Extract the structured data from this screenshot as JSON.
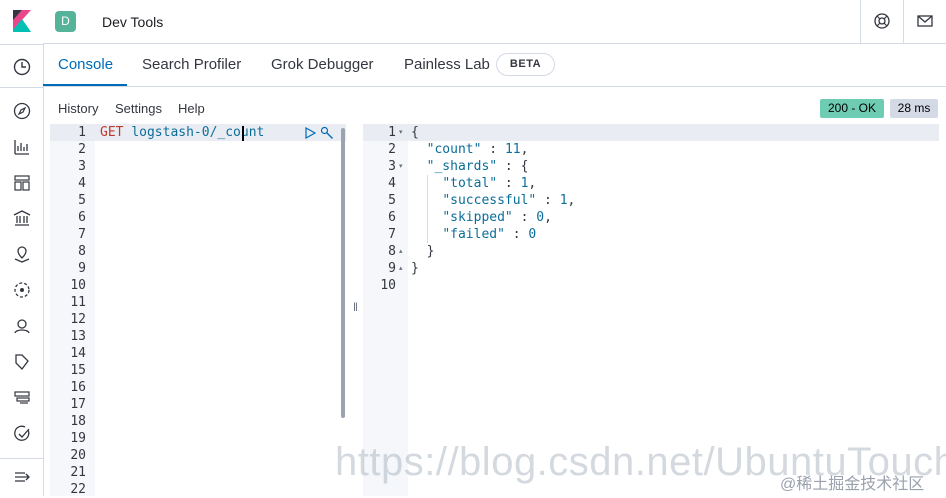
{
  "app": {
    "title": "Dev Tools",
    "space_initial": "D"
  },
  "sidebar": {
    "icons": [
      "clock-icon",
      "compass-icon",
      "chart-icon",
      "dashboard-icon",
      "bank-icon",
      "map-icon",
      "ml-icon",
      "user-icon",
      "apm-icon",
      "stack-icon",
      "uptime-icon",
      "dock-icon"
    ]
  },
  "tabs": [
    {
      "label": "Console",
      "active": true
    },
    {
      "label": "Search Profiler",
      "active": false
    },
    {
      "label": "Grok Debugger",
      "active": false
    },
    {
      "label": "Painless Lab",
      "active": false
    }
  ],
  "beta_label": "BETA",
  "menu": {
    "history": "History",
    "settings": "Settings",
    "help": "Help"
  },
  "status": {
    "code": "200 - OK",
    "time": "28 ms"
  },
  "request": {
    "method": "GET",
    "path": "logstash-0/_count",
    "line_numbers": [
      "1",
      "2",
      "3",
      "4",
      "5",
      "6",
      "7",
      "8",
      "9",
      "10",
      "11",
      "12",
      "13",
      "14",
      "15",
      "16",
      "17",
      "18",
      "19",
      "20",
      "21",
      "22"
    ]
  },
  "response": {
    "line_numbers": [
      "1",
      "2",
      "3",
      "4",
      "5",
      "6",
      "7",
      "8",
      "9",
      "10"
    ],
    "lines": [
      "{",
      "  \"count\" : 11,",
      "  \"_shards\" : {",
      "    \"total\" : 1,",
      "    \"successful\" : 1,",
      "    \"skipped\" : 0,",
      "    \"failed\" : 0",
      "  }",
      "}",
      ""
    ]
  },
  "watermark": {
    "url": "https://blog.csdn.net/UbuntuTouch",
    "site": "@稀土掘金技术社区"
  },
  "colors": {
    "accent": "#006bb8",
    "ok": "#6dccb1",
    "method": "#c0392b"
  }
}
